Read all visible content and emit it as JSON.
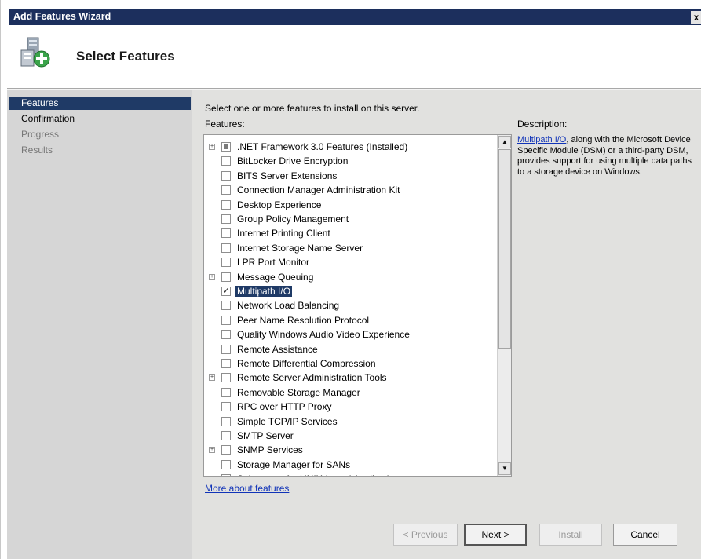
{
  "window": {
    "title": "Add Features Wizard",
    "close_label": "x"
  },
  "header": {
    "title": "Select Features",
    "icon": "features-wizard-icon"
  },
  "nav": {
    "items": [
      {
        "label": "Features",
        "state": "selected"
      },
      {
        "label": "Confirmation",
        "state": "normal"
      },
      {
        "label": "Progress",
        "state": "disabled"
      },
      {
        "label": "Results",
        "state": "disabled"
      }
    ]
  },
  "main": {
    "instruction": "Select one or more features to install on this server.",
    "features_label": "Features:",
    "description_label": "Description:",
    "description_link": "Multipath I/O",
    "description_text": ", along with the Microsoft Device Specific Module (DSM) or a third-party DSM, provides support for using multiple data paths to a storage device on Windows.",
    "features": [
      {
        "label": ".NET Framework 3.0 Features  (Installed)",
        "expandable": true,
        "state": "partial"
      },
      {
        "label": "BitLocker Drive Encryption",
        "expandable": false,
        "state": "unchecked"
      },
      {
        "label": "BITS Server Extensions",
        "expandable": false,
        "state": "unchecked"
      },
      {
        "label": "Connection Manager Administration Kit",
        "expandable": false,
        "state": "unchecked"
      },
      {
        "label": "Desktop Experience",
        "expandable": false,
        "state": "unchecked"
      },
      {
        "label": "Group Policy Management",
        "expandable": false,
        "state": "unchecked"
      },
      {
        "label": "Internet Printing Client",
        "expandable": false,
        "state": "unchecked"
      },
      {
        "label": "Internet Storage Name Server",
        "expandable": false,
        "state": "unchecked"
      },
      {
        "label": "LPR Port Monitor",
        "expandable": false,
        "state": "unchecked"
      },
      {
        "label": "Message Queuing",
        "expandable": true,
        "state": "unchecked"
      },
      {
        "label": "Multipath I/O",
        "expandable": false,
        "state": "checked",
        "selected": true
      },
      {
        "label": "Network Load Balancing",
        "expandable": false,
        "state": "unchecked"
      },
      {
        "label": "Peer Name Resolution Protocol",
        "expandable": false,
        "state": "unchecked"
      },
      {
        "label": "Quality Windows Audio Video Experience",
        "expandable": false,
        "state": "unchecked"
      },
      {
        "label": "Remote Assistance",
        "expandable": false,
        "state": "unchecked"
      },
      {
        "label": "Remote Differential Compression",
        "expandable": false,
        "state": "unchecked"
      },
      {
        "label": "Remote Server Administration Tools",
        "expandable": true,
        "state": "unchecked"
      },
      {
        "label": "Removable Storage Manager",
        "expandable": false,
        "state": "unchecked"
      },
      {
        "label": "RPC over HTTP Proxy",
        "expandable": false,
        "state": "unchecked"
      },
      {
        "label": "Simple TCP/IP Services",
        "expandable": false,
        "state": "unchecked"
      },
      {
        "label": "SMTP Server",
        "expandable": false,
        "state": "unchecked"
      },
      {
        "label": "SNMP Services",
        "expandable": true,
        "state": "unchecked"
      },
      {
        "label": "Storage Manager for SANs",
        "expandable": false,
        "state": "unchecked"
      },
      {
        "label": "Subsystem for UNIX-based Applications",
        "expandable": false,
        "state": "unchecked"
      }
    ],
    "more_link": "More about features"
  },
  "footer": {
    "previous": "< Previous",
    "next": "Next >",
    "install": "Install",
    "cancel": "Cancel"
  },
  "colors": {
    "titlebar": "#1c2f5d",
    "selection": "#1f3a66",
    "link": "#1033b8",
    "panel": "#e1e1df",
    "nav": "#d6d6d6"
  }
}
